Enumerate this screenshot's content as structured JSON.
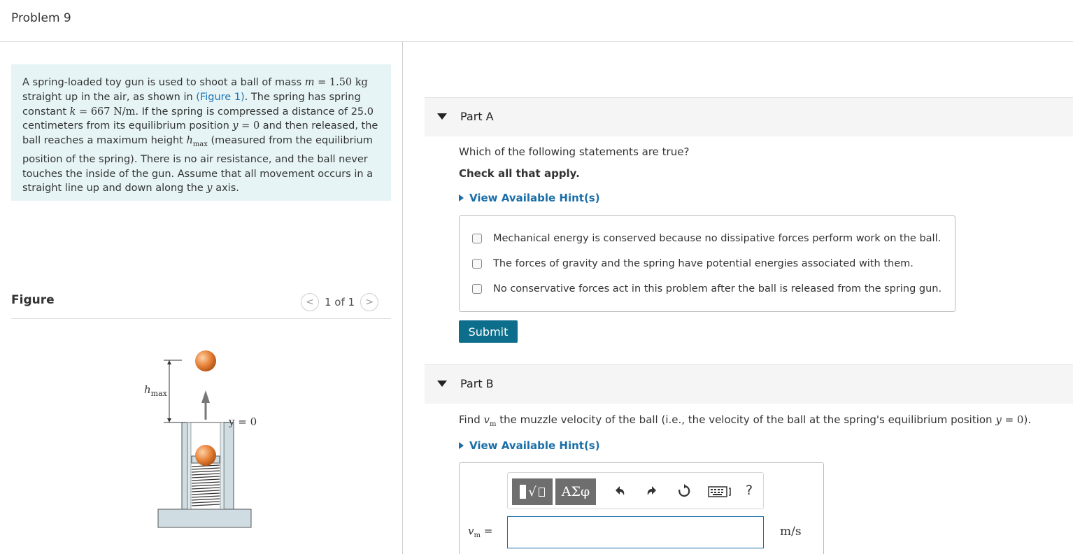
{
  "problem": {
    "title": "Problem 9"
  },
  "statement": {
    "t1": "A spring-loaded toy gun is used to shoot a ball of mass ",
    "m_sym": "m",
    "m_val": " = 1.50 kg",
    "t2": "straight up in the air, as shown in ",
    "fig_link": "(Figure 1)",
    "t3": ". The spring has spring",
    "t4": "constant ",
    "k_sym": "k",
    "k_val": " = 667 N/m",
    "t5": ". If the spring is compressed a distance of 25.0",
    "t6": "centimeters from its equilibrium position ",
    "y_sym": "y",
    "y_val": " = 0",
    "t7": " and then released, the",
    "t8": "ball reaches a maximum height ",
    "h_sym": "h",
    "h_sub": "max",
    "t9": " (measured from the equilibrium",
    "t10": "position of the spring). There is no air resistance, and the ball never",
    "t11": "touches the inside of the gun. Assume that all movement occurs in a",
    "t12": "straight line up and down along the ",
    "yaxis_sym": "y",
    "t13": " axis."
  },
  "figure": {
    "label": "Figure",
    "pager": "1 of 1",
    "prev_icon": "chevron-left-icon",
    "next_icon": "chevron-right-icon",
    "h_label": "h",
    "h_sub": "max",
    "y_label": "y = 0",
    "ball_color": "#e8833a"
  },
  "partA": {
    "name": "Part A",
    "question": "Which of the following statements are true?",
    "instruction": "Check all that apply.",
    "hint": "View Available Hint(s)",
    "choices": [
      "Mechanical energy is conserved because no dissipative forces perform work on the ball.",
      "The forces of gravity and the spring have potential energies associated with them.",
      "No conservative forces act in this problem after the ball is released from the spring gun."
    ],
    "submit": "Submit"
  },
  "partB": {
    "name": "Part B",
    "q1": "Find ",
    "v_sym": "v",
    "v_sub": "m",
    "q2": " the muzzle velocity of the ball (i.e., the velocity of the ball at the spring's equilibrium position ",
    "y_sym": "y",
    "y_val": " = 0",
    "q3": ").",
    "hint": "View Available Hint(s)",
    "greek": "ΑΣφ",
    "help": "?",
    "eq_sym": "v",
    "eq_sub": "m",
    "eq_eq": " =",
    "input_value": "",
    "unit": "m/s"
  },
  "colors": {
    "accent": "#1a6ea8",
    "submit": "#0d6e8c",
    "statement_bg": "#e6f4f5"
  }
}
